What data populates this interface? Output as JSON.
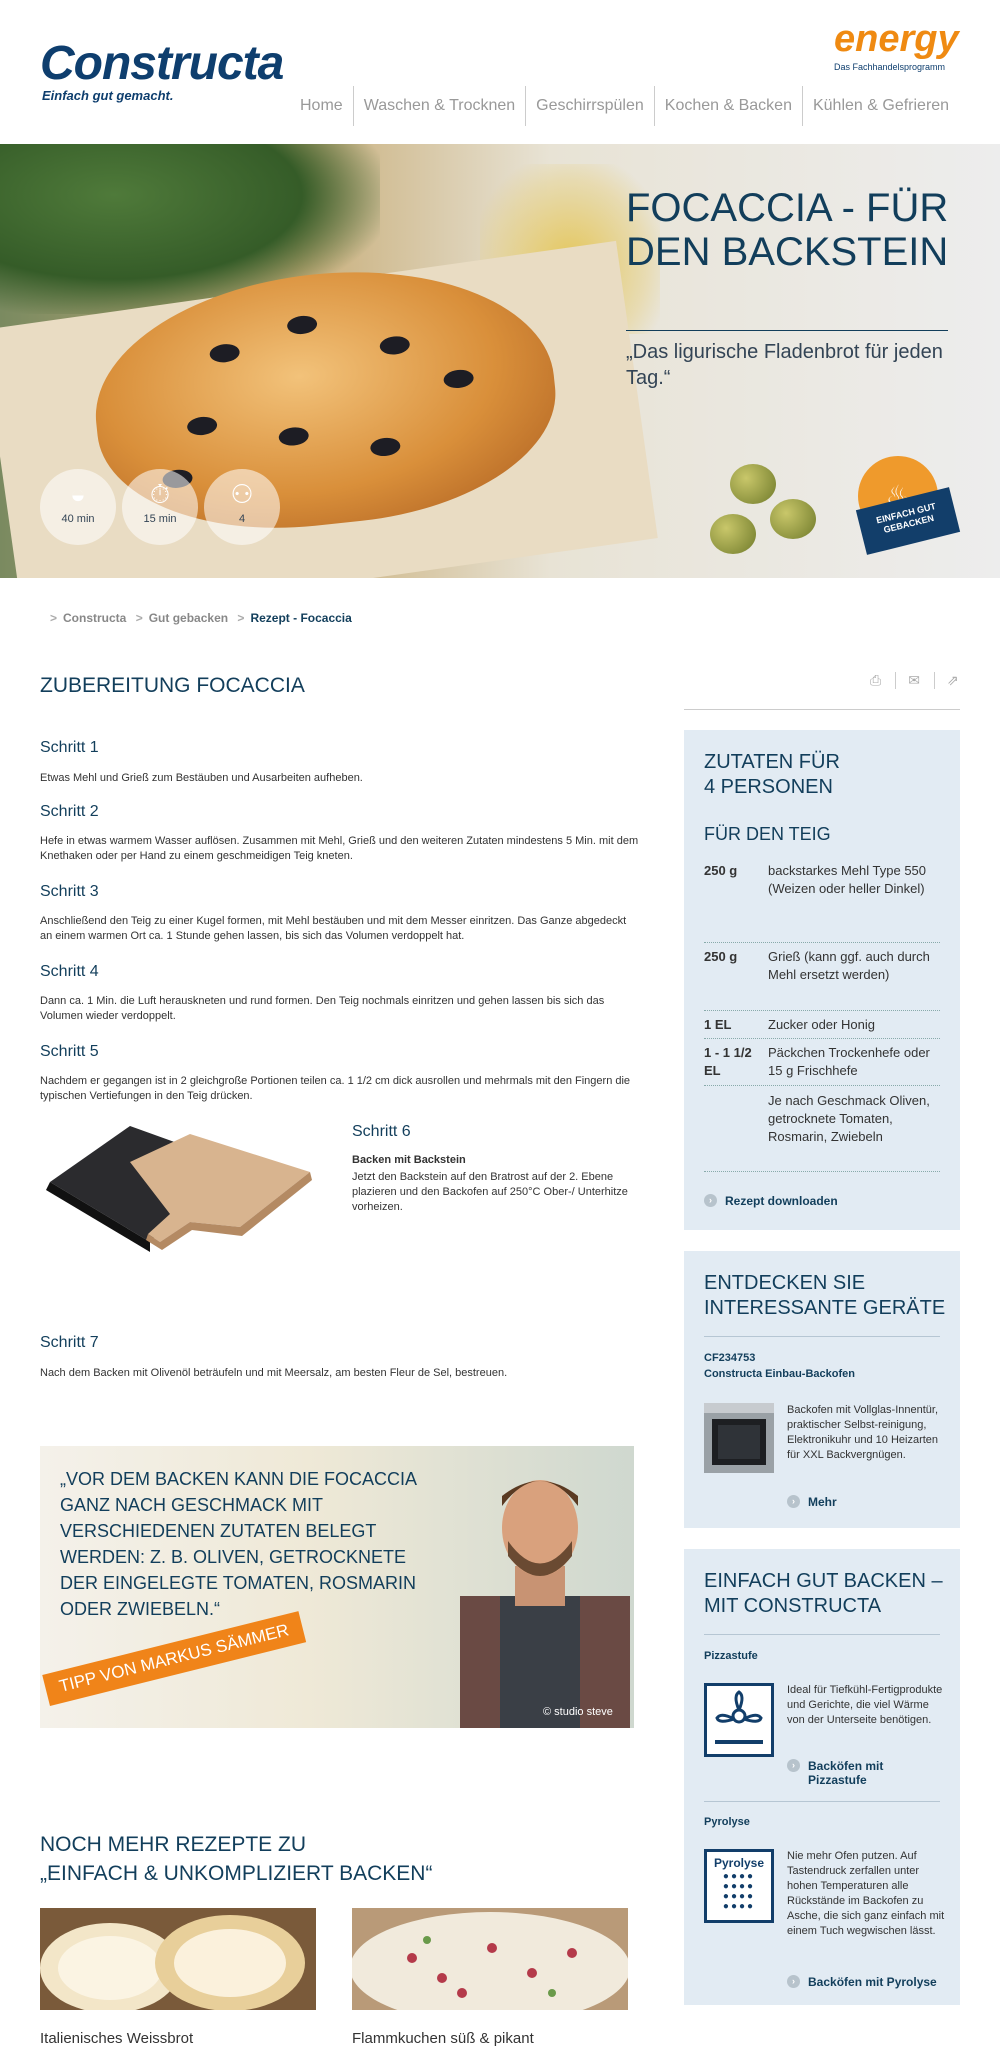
{
  "header": {
    "logo": "Constructa",
    "tagline": "Einfach gut gemacht.",
    "energy_logo": "energy",
    "energy_sub": "Das Fachhandelsprogramm",
    "nav": [
      "Home",
      "Waschen & Trocknen",
      "Geschirrspülen",
      "Kochen & Backen",
      "Kühlen & Gefrieren"
    ]
  },
  "hero": {
    "title": "FOCACCIA - FÜR DEN BACKSTEIN",
    "subtitle": "„Das ligurische Fladenbrot für jeden Tag.“",
    "stats": [
      {
        "icon": "bowl-icon",
        "label": "40 min"
      },
      {
        "icon": "stopwatch-icon",
        "label": "15 min"
      },
      {
        "icon": "persons-icon",
        "label": "4"
      }
    ],
    "badge": "EINFACH GUT GEBACKEN"
  },
  "breadcrumb": [
    "Constructa",
    "Gut gebacken",
    "Rezept - Focaccia"
  ],
  "main": {
    "title": "ZUBEREITUNG FOCACCIA",
    "steps": [
      {
        "h": "Schritt 1",
        "t": "Etwas Mehl und Grieß zum Bestäuben und Ausarbeiten aufheben."
      },
      {
        "h": "Schritt 2",
        "t": "Hefe in etwas warmem Wasser auflösen. Zusammen mit Mehl, Grieß und den weiteren Zutaten mindestens 5 Min. mit dem Knethaken oder per Hand zu einem geschmeidigen Teig kneten."
      },
      {
        "h": "Schritt 3",
        "t": "Anschließend den Teig zu einer Kugel formen, mit Mehl bestäuben und mit dem Messer einritzen. Das Ganze abgedeckt an einem warmen Ort ca. 1 Stunde gehen lassen, bis sich das Volumen verdoppelt hat."
      },
      {
        "h": "Schritt 4",
        "t": "Dann ca. 1 Min. die Luft herauskneten und rund formen. Den Teig nochmals einritzen und gehen lassen bis sich das Volumen wieder verdoppelt."
      },
      {
        "h": "Schritt 5",
        "t": "Nachdem er gegangen ist in 2 gleichgroße Portionen teilen ca. 1 1/2 cm dick ausrollen und mehrmals mit den Fingern die typischen Vertiefungen in den Teig drücken."
      }
    ],
    "step6": {
      "h": "Schritt 6",
      "b": "Backen mit Backstein",
      "t": "Jetzt den Backstein auf den Bratrost auf der 2. Ebene plazieren und den Backofen auf 250°C Ober-/ Unterhitze vorheizen."
    },
    "step7": {
      "h": "Schritt 7",
      "t": "Nach dem Backen mit Olivenöl beträufeln und mit Meersalz, am besten Fleur de Sel, bestreuen."
    }
  },
  "quote": {
    "text": "„VOR DEM BACKEN KANN DIE FOCACCIA GANZ NACH GESCHMACK MIT VERSCHIEDENEN ZUTATEN BELEGT WERDEN: Z. B. OLIVEN, GETROCKNETE DER EINGELEGTE TOMATEN, ROSMARIN ODER ZWIEBELN.“",
    "tag": "TIPP VON MARKUS SÄMMER",
    "credit": "© studio steve"
  },
  "more": {
    "title_line1": "NOCH MEHR REZEPTE ZU",
    "title_line2": "„EINFACH & UNKOMPLIZIERT BACKEN“",
    "recipes": [
      "Italienisches Weissbrot",
      "Flammkuchen süß & pikant"
    ]
  },
  "sidebar": {
    "tools": [
      "print-icon",
      "mail-icon",
      "share-icon"
    ],
    "ingredients": {
      "title_line1": "ZUTATEN FÜR",
      "title_line2": "4 PERSONEN",
      "sub": "FÜR DEN TEIG",
      "items": [
        {
          "q": "250 g",
          "n": "backstarkes Mehl Type 550 (Weizen oder heller Dinkel)"
        },
        {
          "q": "250 g",
          "n": "Grieß (kann ggf. auch durch Mehl ersetzt werden)"
        },
        {
          "q": "1 EL",
          "n": "Zucker oder Honig"
        },
        {
          "q": "1 - 1 1/2 EL",
          "n": "Päckchen Trockenhefe oder 15 g Frischhefe"
        },
        {
          "q": "",
          "n": "Je nach Geschmack Oliven, getrocknete Tomaten, Rosmarin, Zwiebeln"
        }
      ],
      "download": "Rezept downloaden"
    },
    "devices": {
      "title_line1": "ENTDECKEN SIE",
      "title_line2": "INTERESSANTE GERÄTE",
      "model": "CF234753",
      "name": "Constructa Einbau-Backofen",
      "desc": "Backofen mit Vollglas-Innentür, praktischer Selbst-reinigung, Elektronikuhr und 10 Heizarten für XXL Backvergnügen.",
      "more": "Mehr"
    },
    "baking": {
      "title_line1": "EINFACH GUT BACKEN –",
      "title_line2": "MIT CONSTRUCTA",
      "f1_title": "Pizzastufe",
      "f1_desc": "Ideal für Tiefkühl-Fertigprodukte und Gerichte, die viel Wärme von der Unterseite benötigen.",
      "f1_link": "Backöfen mit Pizzastufe",
      "f2_title": "Pyrolyse",
      "f2_icon_label": "Pyrolyse",
      "f2_desc": "Nie mehr Ofen putzen. Auf Tastendruck zerfallen unter hohen Temperaturen alle Rückstände im Backofen zu Asche, die sich ganz einfach mit einem Tuch wegwischen lässt.",
      "f2_link": "Backöfen mit Pyrolyse"
    }
  }
}
